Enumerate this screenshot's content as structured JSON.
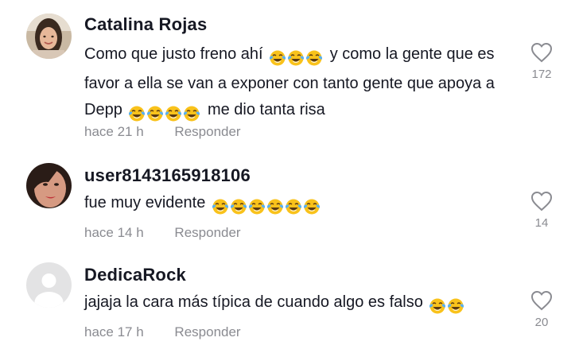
{
  "comments": [
    {
      "username": "Catalina Rojas",
      "text_before": "Como que justo freno ahí",
      "emoji_a_count": 3,
      "text_mid": "y como la gente que es favor a ella se van a exponer con tanto gente que apoya a Depp",
      "emoji_b_count": 4,
      "text_after": "me dio tanta risa",
      "time": "hace 21 h",
      "reply_label": "Responder",
      "likes": "172",
      "avatar": "photo-woman-smiling",
      "emoji": "face-with-tears-of-joy"
    },
    {
      "username": "user8143165918106",
      "text_before": "fue muy evidente",
      "emoji_a_count": 6,
      "time": "hace 14 h",
      "reply_label": "Responder",
      "likes": "14",
      "avatar": "photo-woman-closeup",
      "emoji": "face-with-tears-of-joy"
    },
    {
      "username": "DedicaRock",
      "text_before": "jajaja la cara más típica de cuando algo es falso",
      "emoji_a_count": 2,
      "time": "hace 17 h",
      "reply_label": "Responder",
      "likes": "20",
      "avatar": "default-avatar",
      "emoji": "face-with-tears-of-joy"
    }
  ],
  "colors": {
    "text": "#161823",
    "muted": "#8a8b91",
    "heart_outline": "#8a8b91",
    "emoji_yellow": "#f9c21b",
    "emoji_tears": "#5ab0f0"
  },
  "icons": {
    "like": "heart-outline-icon"
  }
}
